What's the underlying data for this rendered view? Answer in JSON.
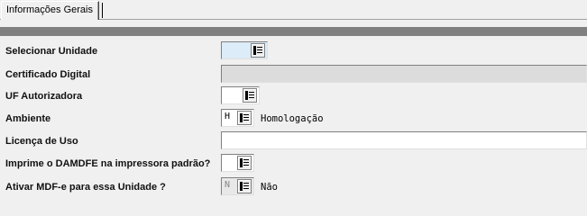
{
  "tabs": [
    {
      "label": "Informações Gerais"
    }
  ],
  "form": {
    "rows": [
      {
        "label": "Selecionar Unidade",
        "code": "",
        "desc": ""
      },
      {
        "label": "Certificado Digital",
        "value": ""
      },
      {
        "label": "UF Autorizadora",
        "code": "",
        "desc": ""
      },
      {
        "label": "Ambiente",
        "code": "H",
        "desc": "Homologação"
      },
      {
        "label": "Licença de Uso",
        "value": ""
      },
      {
        "label": "Imprime o DAMDFE na impressora padrão?",
        "code": "",
        "desc": ""
      },
      {
        "label": "Ativar MDF-e para essa Unidade ?",
        "code": "N",
        "desc": "Não"
      }
    ]
  },
  "icons": {
    "lookup": "list-lookup-icon"
  },
  "colors": {
    "header_bar": "#808080",
    "background": "#f0f0f0",
    "selected_field": "#dcecf8"
  }
}
